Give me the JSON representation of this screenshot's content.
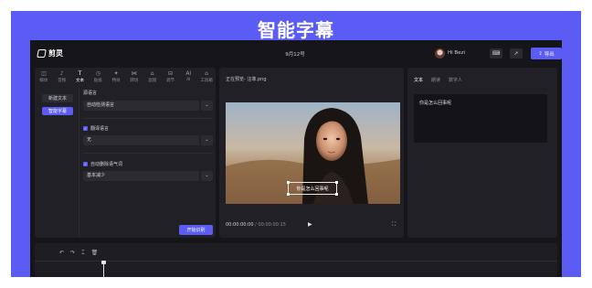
{
  "banner": {
    "title": "智能字幕"
  },
  "app": {
    "logo_text": "剪灵",
    "date": "9月12号",
    "user_name": "Hi Bezi",
    "export_label": "导出"
  },
  "tool_tabs": [
    {
      "icon": "◫",
      "label": "媒体",
      "icon_name": "media-icon"
    },
    {
      "icon": "♪",
      "label": "音频",
      "icon_name": "audio-icon"
    },
    {
      "icon": "T",
      "label": "文本",
      "icon_name": "text-icon",
      "active": true
    },
    {
      "icon": "◷",
      "label": "贴纸",
      "icon_name": "sticker-icon"
    },
    {
      "icon": "✦",
      "label": "特效",
      "icon_name": "effects-icon"
    },
    {
      "icon": "⋈",
      "label": "转场",
      "icon_name": "transition-icon"
    },
    {
      "icon": "⌂",
      "label": "滤镜",
      "icon_name": "filter-icon"
    },
    {
      "icon": "⊟",
      "label": "调节",
      "icon_name": "adjust-icon"
    },
    {
      "icon": "AI",
      "label": "AI",
      "icon_name": "ai-icon"
    },
    {
      "icon": "⌂",
      "label": "工具箱",
      "icon_name": "toolbox-icon"
    }
  ],
  "sub_nav": {
    "new_text": "新建文本",
    "smart_subtitle": "智能字幕"
  },
  "settings": {
    "source_language_label": "源语言",
    "source_language_value": "自动检测语言",
    "translate_label": "翻译语言",
    "translate_value": "无",
    "auto_clean_label": "自动删除语气词",
    "auto_clean_value": "基本减少",
    "start_label": "开始识别"
  },
  "preview": {
    "title": "正在预览- 汪菲.png",
    "subtitle": "你是怎么回事呢",
    "time_current": "00:00:00:00",
    "time_sep": "/",
    "time_total": "00:00:00:15"
  },
  "right_panel": {
    "tabs": [
      "文本",
      "朗读",
      "数字人"
    ],
    "text_content": "你是怎么回事呢"
  },
  "colors": {
    "accent": "#5b5cf4",
    "background": "#16161a",
    "panel": "#202026"
  }
}
